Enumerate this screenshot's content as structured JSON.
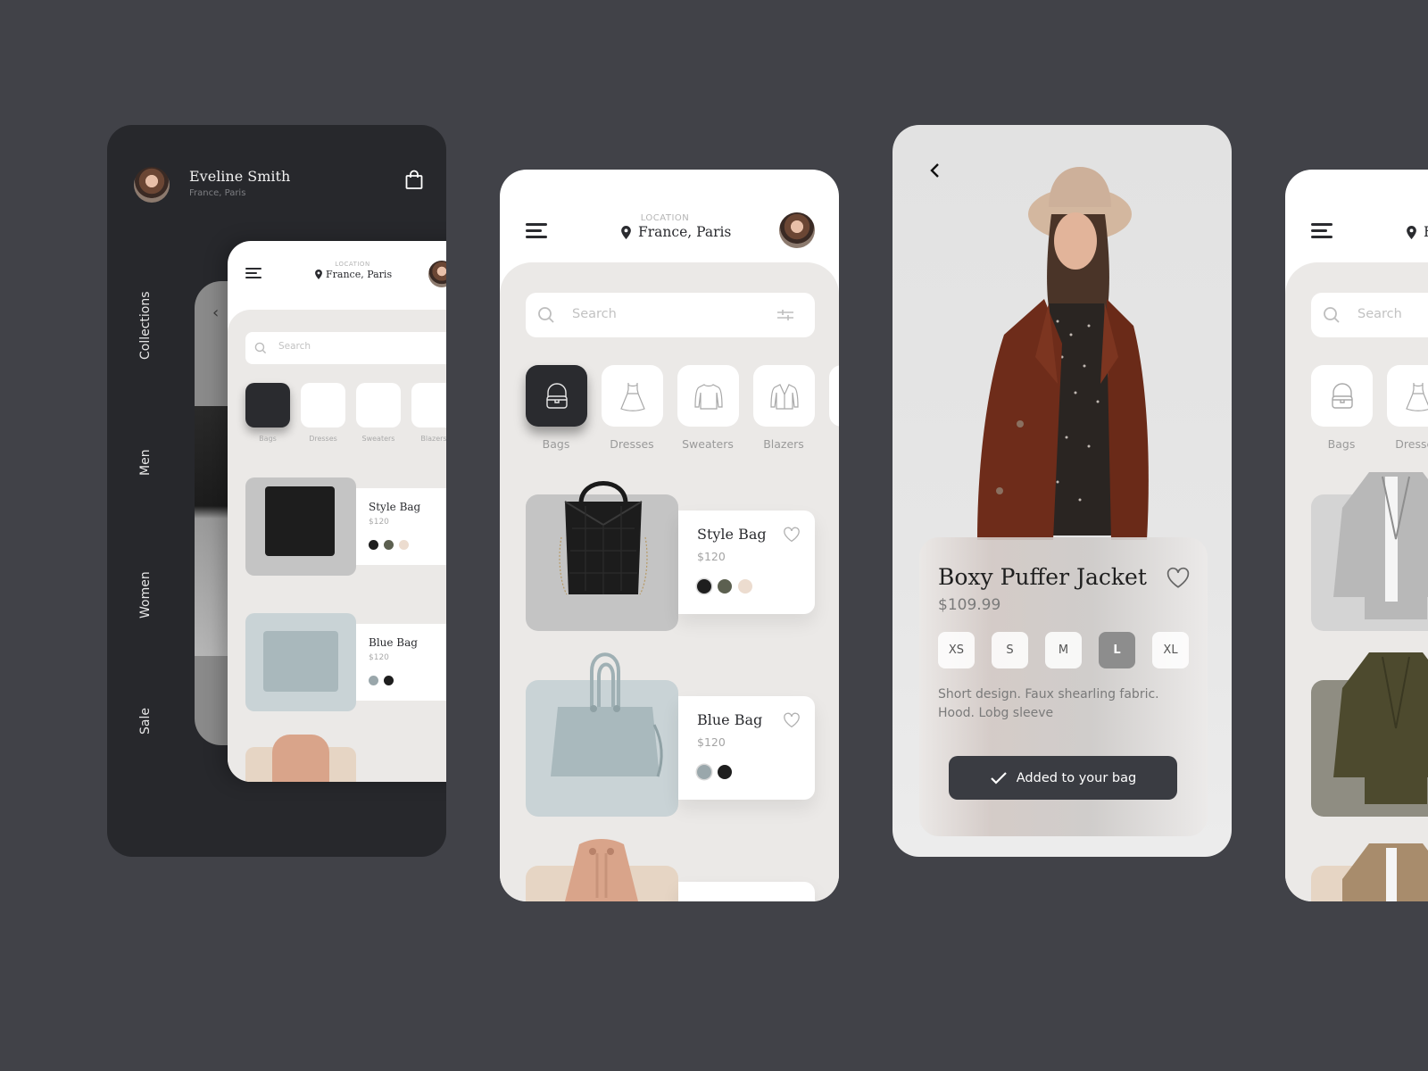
{
  "colors": {
    "background": "#414248",
    "dark_panel": "#27282c",
    "screen_bg": "#ebe9e7",
    "primary_dark": "#2a2b2f",
    "button_dark": "#3a3c42"
  },
  "drawer": {
    "user_name": "Eveline Smith",
    "user_location": "France, Paris",
    "cart_icon": "shopping-bag-icon",
    "nav": [
      {
        "label": "Collections"
      },
      {
        "label": "Men"
      },
      {
        "label": "Women"
      },
      {
        "label": "Sale"
      }
    ]
  },
  "home": {
    "location_label": "LOCATION",
    "location_value": "France, Paris",
    "search_placeholder": "Search",
    "categories": [
      {
        "label": "Bags",
        "icon": "handbag-icon",
        "active": true
      },
      {
        "label": "Dresses",
        "icon": "dress-icon",
        "active": false
      },
      {
        "label": "Sweaters",
        "icon": "sweater-icon",
        "active": false
      },
      {
        "label": "Blazers",
        "icon": "blazer-icon",
        "active": false
      }
    ],
    "products": [
      {
        "name": "Style Bag",
        "price": "$120",
        "swatches": [
          "#1e1e1e",
          "#5c6050",
          "#ecdccf"
        ],
        "image_bg": "#c4c4c4"
      },
      {
        "name": "Blue Bag",
        "price": "$120",
        "swatches": [
          "#9aa7ab",
          "#1e1e1e"
        ],
        "image_bg": "#c9d3d6"
      },
      {
        "name": "",
        "price": "",
        "swatches": [],
        "image_bg": "#e6d5c4"
      }
    ]
  },
  "blazers": {
    "location_value": "France, Paris",
    "search_placeholder": "Search",
    "categories": [
      {
        "label": "Bags"
      },
      {
        "label": "Dresses"
      }
    ],
    "products": [
      {
        "image_bg": "#d4d4d4"
      },
      {
        "image_bg": "#8f8d82"
      },
      {
        "image_bg": "#e6d5c4"
      }
    ]
  },
  "detail": {
    "title": "Boxy Puffer Jacket",
    "price": "$109.99",
    "sizes": [
      {
        "label": "XS",
        "selected": false
      },
      {
        "label": "S",
        "selected": false
      },
      {
        "label": "M",
        "selected": false
      },
      {
        "label": "L",
        "selected": true
      },
      {
        "label": "XL",
        "selected": false
      }
    ],
    "description": "Short design. Faux shearling fabric. Hood. Lobg sleeve",
    "cta_label": "Added to your bag"
  }
}
